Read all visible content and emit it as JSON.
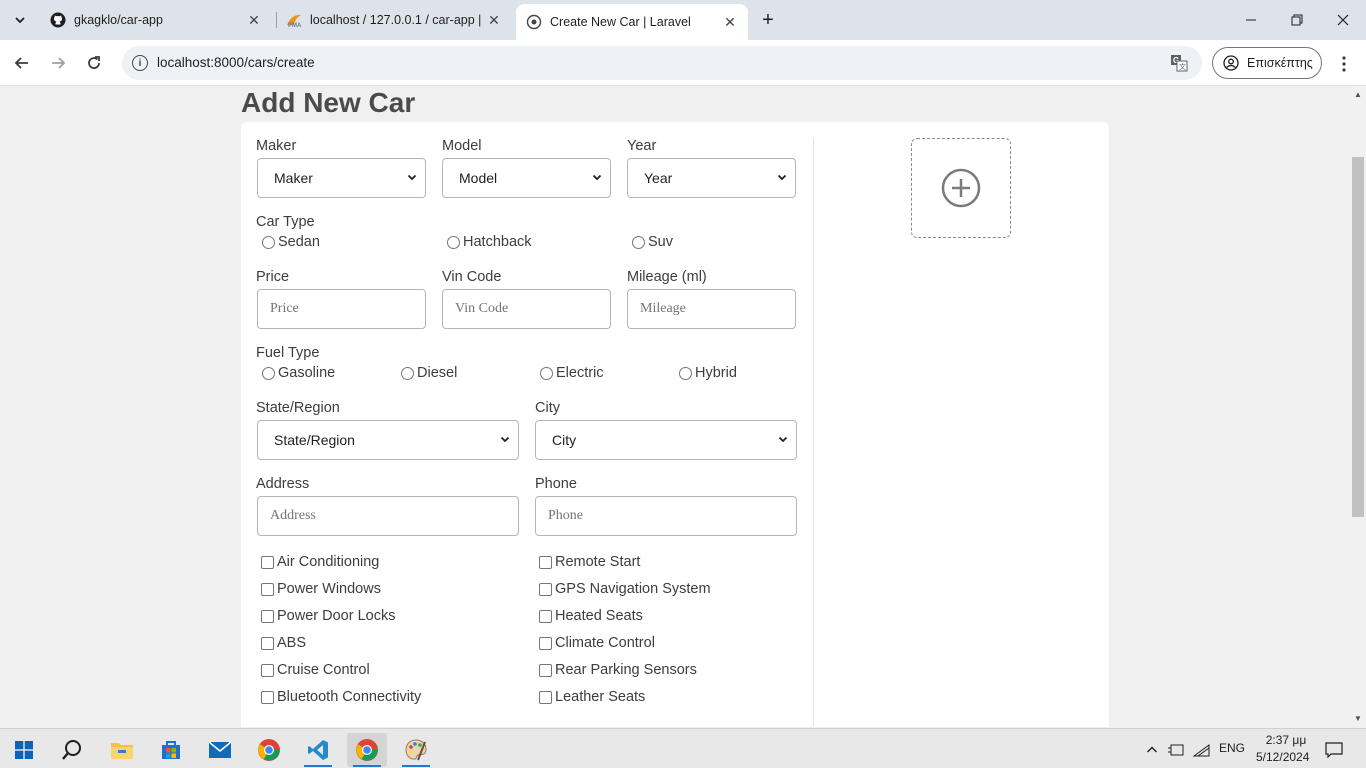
{
  "browser": {
    "tabs": [
      {
        "title": "gkagklo/car-app",
        "favicon": "github-icon",
        "active": false
      },
      {
        "title": "localhost / 127.0.0.1 / car-app |",
        "favicon": "phpmyadmin-icon",
        "active": false
      },
      {
        "title": "Create New Car | Laravel",
        "favicon": "globe-icon",
        "active": true
      }
    ],
    "url": "localhost:8000/cars/create",
    "profile_label": "Επισκέπτης"
  },
  "page": {
    "title": "Add New Car"
  },
  "form": {
    "maker": {
      "label": "Maker",
      "selected": "Maker"
    },
    "model": {
      "label": "Model",
      "selected": "Model"
    },
    "year": {
      "label": "Year",
      "selected": "Year"
    },
    "car_type": {
      "label": "Car Type",
      "options": [
        "Sedan",
        "Hatchback",
        "Suv"
      ]
    },
    "price": {
      "label": "Price",
      "placeholder": "Price"
    },
    "vin": {
      "label": "Vin Code",
      "placeholder": "Vin Code"
    },
    "mileage": {
      "label": "Mileage (ml)",
      "placeholder": "Mileage"
    },
    "fuel_type": {
      "label": "Fuel Type",
      "options": [
        "Gasoline",
        "Diesel",
        "Electric",
        "Hybrid"
      ]
    },
    "state": {
      "label": "State/Region",
      "selected": "State/Region"
    },
    "city": {
      "label": "City",
      "selected": "City"
    },
    "address": {
      "label": "Address",
      "placeholder": "Address"
    },
    "phone": {
      "label": "Phone",
      "placeholder": "Phone"
    },
    "features_left": [
      "Air Conditioning",
      "Power Windows",
      "Power Door Locks",
      "ABS",
      "Cruise Control",
      "Bluetooth Connectivity"
    ],
    "features_right": [
      "Remote Start",
      "GPS Navigation System",
      "Heated Seats",
      "Climate Control",
      "Rear Parking Sensors",
      "Leather Seats"
    ]
  },
  "taskbar": {
    "lang": "ENG",
    "time": "2:37 μμ",
    "date": "5/12/2024"
  }
}
